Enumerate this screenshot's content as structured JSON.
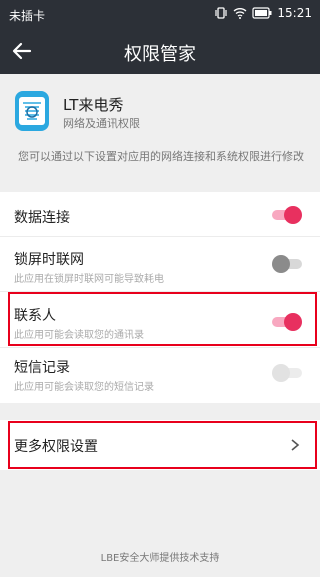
{
  "status_bar": {
    "carrier": "未插卡",
    "time": "15:21"
  },
  "app_bar": {
    "title": "权限管家"
  },
  "app_info": {
    "name": "LT来电秀",
    "subtitle": "网络及通讯权限",
    "description": "您可以通过以下设置对应用的网络连接和系统权限进行修改"
  },
  "permissions": [
    {
      "label": "数据连接",
      "description": "",
      "state": "on"
    },
    {
      "label": "锁屏时联网",
      "description": "此应用在锁屏时联网可能导致耗电",
      "state": "off"
    },
    {
      "label": "联系人",
      "description": "此应用可能会读取您的通讯录",
      "state": "on"
    },
    {
      "label": "短信记录",
      "description": "此应用可能会读取您的短信记录",
      "state": "disabled"
    }
  ],
  "more": {
    "label": "更多权限设置"
  },
  "footer": {
    "text": "LBE安全大师提供技术支持"
  },
  "colors": {
    "accent": "#e8305f",
    "header": "#2c3037",
    "highlight": "#e8001c"
  }
}
